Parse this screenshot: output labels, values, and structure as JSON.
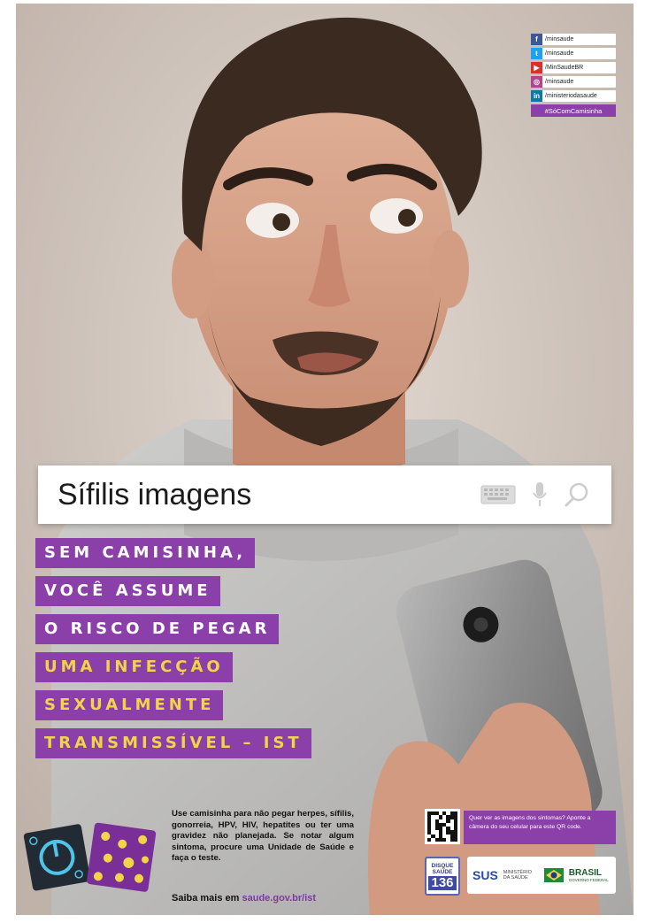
{
  "social": {
    "rows": [
      {
        "icon": "facebook-icon",
        "label": "/minsaude",
        "color": "#3b5998"
      },
      {
        "icon": "twitter-icon",
        "label": "/minsaude",
        "color": "#1da1f2"
      },
      {
        "icon": "youtube-icon",
        "label": "/MinSaudeBR",
        "color": "#d9302c"
      },
      {
        "icon": "instagram-icon",
        "label": "/minsaude",
        "color": "#b0458a"
      },
      {
        "icon": "linkedin-icon",
        "label": "/ministeriodasaude",
        "color": "#0e76a8"
      }
    ],
    "hashtag": "#SóComCamisinha"
  },
  "search": {
    "query": "Sífilis imagens"
  },
  "headline": {
    "lines": [
      {
        "text": "SEM CAMISINHA,",
        "yellow": false
      },
      {
        "text": "VOCÊ ASSUME",
        "yellow": false
      },
      {
        "text": "O RISCO DE PEGAR",
        "yellow": false
      },
      {
        "text": "UMA INFECÇÃO",
        "yellow": true
      },
      {
        "text": "SEXUALMENTE",
        "yellow": true
      },
      {
        "text": "TRANSMISSÍVEL – IST",
        "yellow": true
      }
    ]
  },
  "body_copy": "Use camisinha para não pegar herpes, sífilis, gonorreia, HPV, HIV, hepatites ou ter uma gravidez não planejada. Se notar algum sintoma, procure uma Unidade de Saúde e faça o teste.",
  "more": {
    "prefix": "Saiba mais em",
    "link": "saude.gov.br/ist"
  },
  "qr": {
    "text": "Quer ver as imagens dos sintomas? Aponte a câmera do seu celular para este QR code."
  },
  "disque": {
    "line1": "DISQUE",
    "line2": "SAÚDE",
    "number": "136"
  },
  "gov": {
    "sus": "SUS",
    "ministerio": "MINISTÉRIO DA SAÚDE",
    "brasil": "BRASIL",
    "governo": "GOVERNO FEDERAL"
  },
  "colors": {
    "purple": "#8b3fa8",
    "yellow": "#f2d44a"
  }
}
